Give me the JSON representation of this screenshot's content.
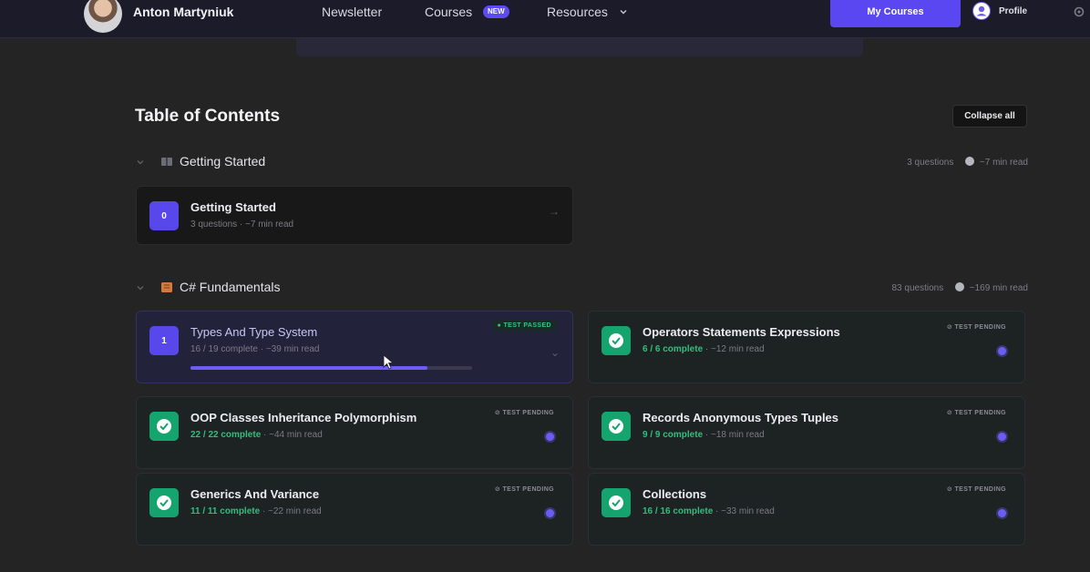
{
  "nav": {
    "brand": "Anton Martyniuk",
    "links": {
      "newsletter": "Newsletter",
      "courses": "Courses",
      "courses_badge": "NEW",
      "resources": "Resources"
    },
    "my_courses": "My Courses",
    "profile": "Profile"
  },
  "toc": {
    "title": "Table of Contents",
    "collapse": "Collapse all"
  },
  "sections": [
    {
      "title": "Getting Started",
      "icon": "book-icon",
      "questions": "3 questions",
      "read": "~7 min read",
      "cards": [
        {
          "num": "0",
          "title": "Getting Started",
          "meta": "3 questions · ~7 min read"
        }
      ]
    },
    {
      "title": "C# Fundamentals",
      "icon": "code-book-icon",
      "questions": "83 questions",
      "read": "~169 min read",
      "cards": [
        {
          "num": "1",
          "title": "Types And Type System",
          "complete": "16 / 19 complete",
          "read": " · ~39 min read",
          "status": "TEST PASSED",
          "progress": 0.84
        },
        {
          "title": "Operators Statements Expressions",
          "complete": "6 / 6 complete",
          "read": " · ~12 min read",
          "status": "TEST PENDING"
        },
        {
          "title": "OOP Classes Inheritance Polymorphism",
          "complete": "22 / 22 complete",
          "read": " · ~44 min read",
          "status": "TEST PENDING"
        },
        {
          "title": "Records Anonymous Types Tuples",
          "complete": "9 / 9 complete",
          "read": " · ~18 min read",
          "status": "TEST PENDING"
        },
        {
          "title": "Generics And Variance",
          "complete": "11 / 11 complete",
          "read": " · ~22 min read",
          "status": "TEST PENDING"
        },
        {
          "title": "Collections",
          "complete": "16 / 16 complete",
          "read": " · ~33 min read",
          "status": "TEST PENDING"
        }
      ]
    }
  ],
  "colors": {
    "accent": "#5b47f2",
    "success": "#15a46d",
    "background": "#242424"
  }
}
